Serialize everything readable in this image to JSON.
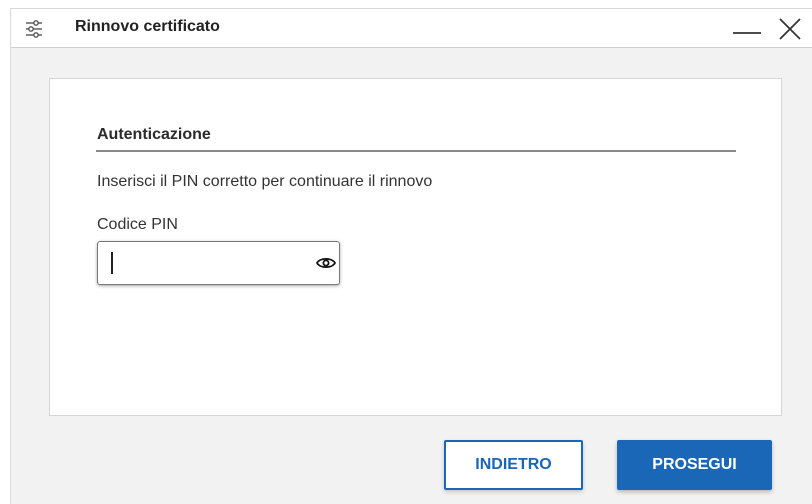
{
  "window": {
    "title": "Rinnovo certificato",
    "settings_icon": "sliders-icon",
    "minimize_icon": "minimize-icon",
    "close_icon": "close-icon"
  },
  "form": {
    "section_title": "Autenticazione",
    "description": "Inserisci il PIN corretto per continuare il rinnovo",
    "pin_label": "Codice PIN",
    "pin_value": "",
    "pin_visibility_icon": "eye-icon"
  },
  "actions": {
    "back_label": "INDIETRO",
    "next_label": "PROSEGUI"
  },
  "colors": {
    "accent": "#1a67b8",
    "background": "#f2f2f2",
    "card": "#ffffff"
  }
}
